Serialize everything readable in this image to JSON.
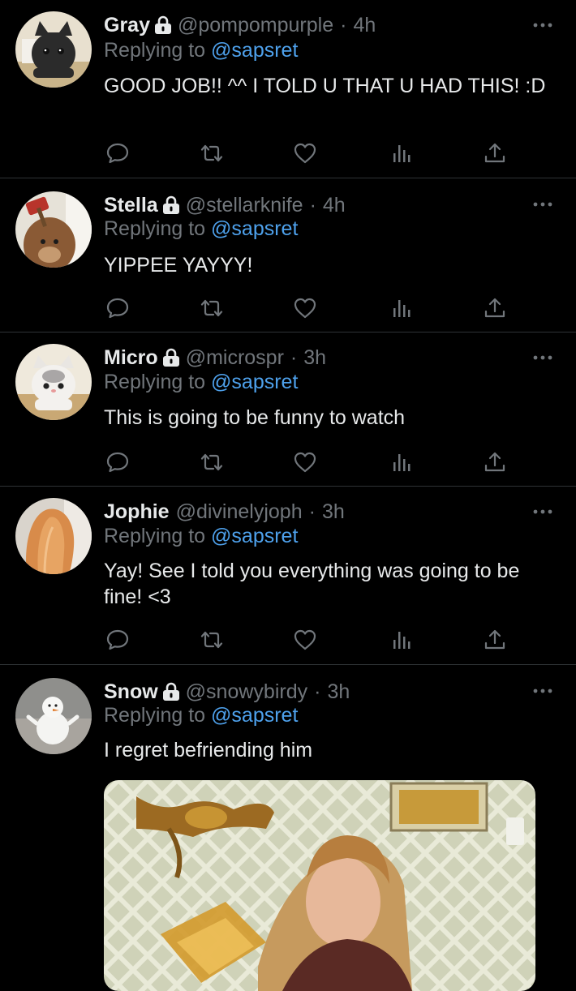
{
  "replying_label": "Replying to",
  "tweets": [
    {
      "name": "Gray",
      "handle": "@pompompurple",
      "dot": "·",
      "time": "4h",
      "reply_to": "@sapsret",
      "text": "GOOD JOB!! ^^ I TOLD U THAT U HAD THIS! :D",
      "locked": true
    },
    {
      "name": "Stella",
      "handle": "@stellarknife",
      "dot": "·",
      "time": "4h",
      "reply_to": "@sapsret",
      "text": "YIPPEE YAYYY!",
      "locked": true
    },
    {
      "name": "Micro",
      "handle": "@microspr",
      "dot": "·",
      "time": "3h",
      "reply_to": "@sapsret",
      "text": "This is going to be funny to watch",
      "locked": true
    },
    {
      "name": "Jophie",
      "handle": "@divinelyjoph",
      "dot": "·",
      "time": "3h",
      "reply_to": "@sapsret",
      "text": "Yay! See I told you everything was going to be fine! <3",
      "locked": false
    },
    {
      "name": "Snow",
      "handle": "@snowybirdy",
      "dot": "·",
      "time": "3h",
      "reply_to": "@sapsret",
      "text": "I regret befriending him",
      "locked": true,
      "has_media": true
    }
  ],
  "icons": {
    "reply": "reply-icon",
    "retweet": "retweet-icon",
    "like": "heart-icon",
    "views": "views-icon",
    "share": "share-icon",
    "more": "more-icon",
    "lock": "lock-icon"
  },
  "colors": {
    "background": "#000000",
    "text": "#e7e9ea",
    "muted": "#71767b",
    "mention": "#4ea1ec",
    "divider": "#2f3336"
  }
}
